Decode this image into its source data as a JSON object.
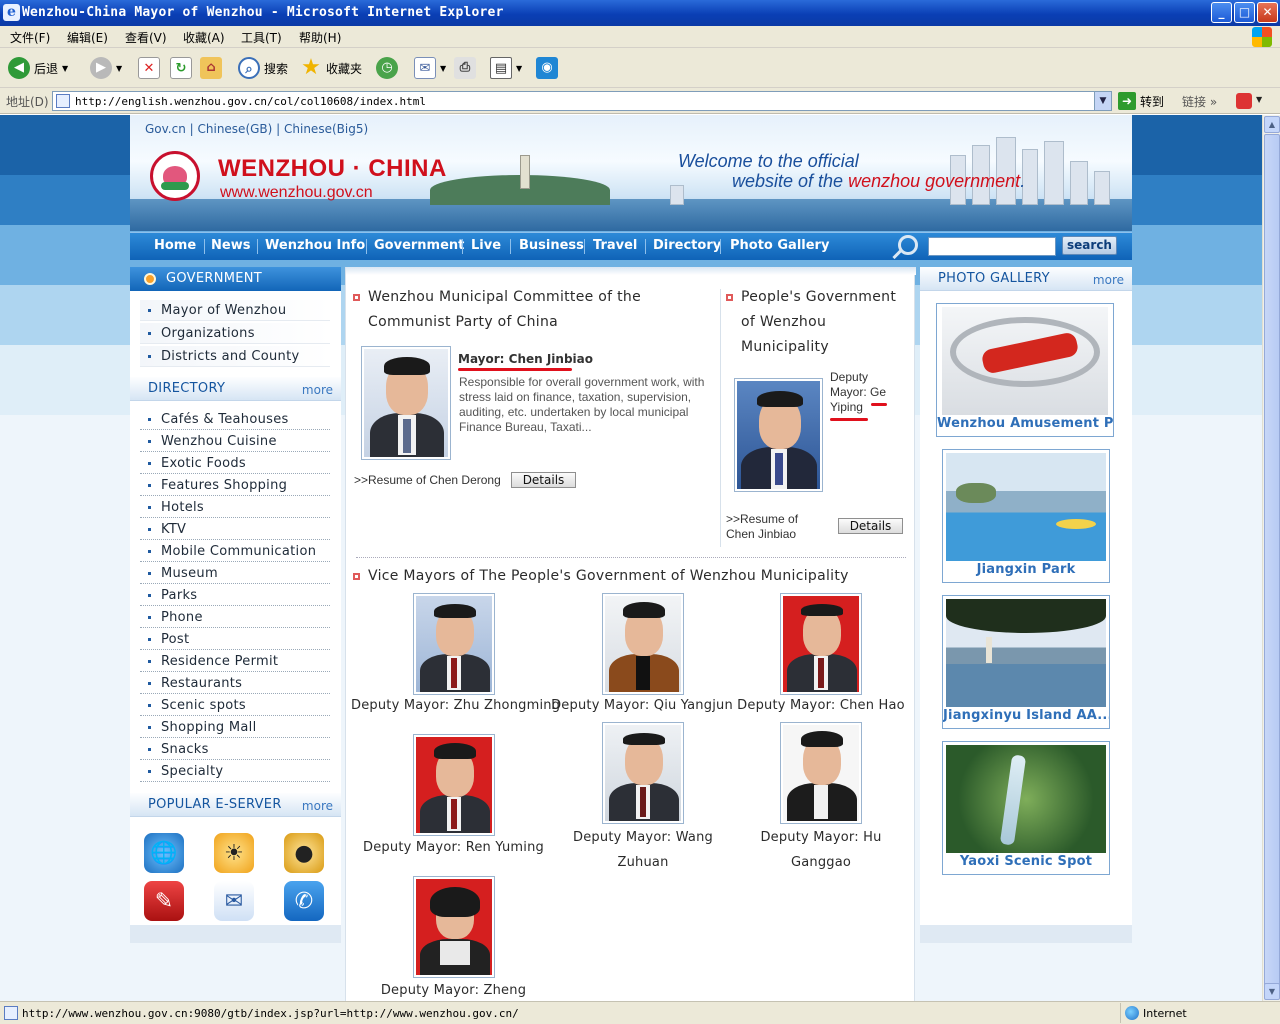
{
  "window": {
    "title": "Wenzhou-China Mayor of Wenzhou - Microsoft Internet Explorer",
    "minimize": "_",
    "maximize": "□",
    "close": "✕"
  },
  "menu": [
    "文件(F)",
    "编辑(E)",
    "查看(V)",
    "收藏(A)",
    "工具(T)",
    "帮助(H)"
  ],
  "toolbar": {
    "back": "后退",
    "search": "搜索",
    "favorites": "收藏夹"
  },
  "address": {
    "label": "地址(D)",
    "url": "http://english.wenzhou.gov.cn/col/col10608/index.html",
    "go": "转到",
    "links": "链接"
  },
  "site": {
    "top_links": "Gov.cn | Chinese(GB) | Chinese(Big5)",
    "name": "WENZHOU · CHINA",
    "url": "www.wenzhou.gov.cn",
    "welcome_line1": "Welcome to the official",
    "welcome_line2_prefix": "website of the ",
    "welcome_line2_red": "wenzhou government",
    "welcome_line2_suffix": "."
  },
  "nav": {
    "items": [
      "Home",
      "News",
      "Wenzhou Info",
      "Government",
      "Live",
      "Business",
      "Travel",
      "Directory",
      "Photo Gallery"
    ],
    "search_button": "search"
  },
  "left": {
    "government_title": "GOVERNMENT",
    "government_items": [
      "Mayor of Wenzhou",
      "Organizations",
      "Districts and County"
    ],
    "directory_title": "DIRECTORY",
    "more": "more",
    "directory_items": [
      "Cafés & Teahouses",
      "Wenzhou Cuisine",
      "Exotic Foods",
      "Features Shopping",
      "Hotels",
      "KTV",
      "Mobile Communication",
      "Museum",
      "Parks",
      "Phone",
      "Post",
      "Residence Permit",
      "Restaurants",
      "Scenic spots",
      "Shopping Mall",
      "Snacks",
      "Specialty"
    ],
    "eserver_title": "POPULAR E-SERVER",
    "eserver_icons": [
      "globe-icon",
      "weather-icon",
      "coins-icon",
      "notebook-icon",
      "mail-question-icon",
      "phone-icon"
    ]
  },
  "center": {
    "committee_title": "Wenzhou Municipal Committee of the Communist Party of China",
    "mayor_label": "Mayor: Chen Jinbiao",
    "mayor_desc": "Responsible for overall government work, with stress laid on finance, taxation, supervision, auditing, etc. undertaken by local municipal Finance Bureau, Taxati...",
    "resume_left": ">>Resume of Chen Derong",
    "details": "Details",
    "govt_title": "People's Government of Wenzhou Municipality",
    "deputy_label": "Deputy Mayor: Ge Yiping",
    "resume_right": ">>Resume of Chen Jinbiao",
    "vice_title": "Vice Mayors of The People's Government of Wenzhou Municipality",
    "vice_mayors": [
      "Deputy Mayor: Zhu Zhongming",
      "Deputy Mayor: Qiu Yangjun",
      "Deputy Mayor: Chen Hao",
      "Deputy Mayor: Ren Yuming",
      "Deputy Mayor: Wang Zuhuan",
      "Deputy Mayor: Hu Ganggao",
      "Deputy Mayor: Zheng"
    ]
  },
  "right": {
    "title": "PHOTO GALLERY",
    "more": "more",
    "photos": [
      "Wenzhou Amusement Pa...",
      "Jiangxin Park",
      "Jiangxinyu Island AA...",
      "Yaoxi Scenic Spot"
    ]
  },
  "status": {
    "text": "http://www.wenzhou.gov.cn:9080/gtb/index.jsp?url=http://www.wenzhou.gov.cn/",
    "zone": "Internet"
  }
}
